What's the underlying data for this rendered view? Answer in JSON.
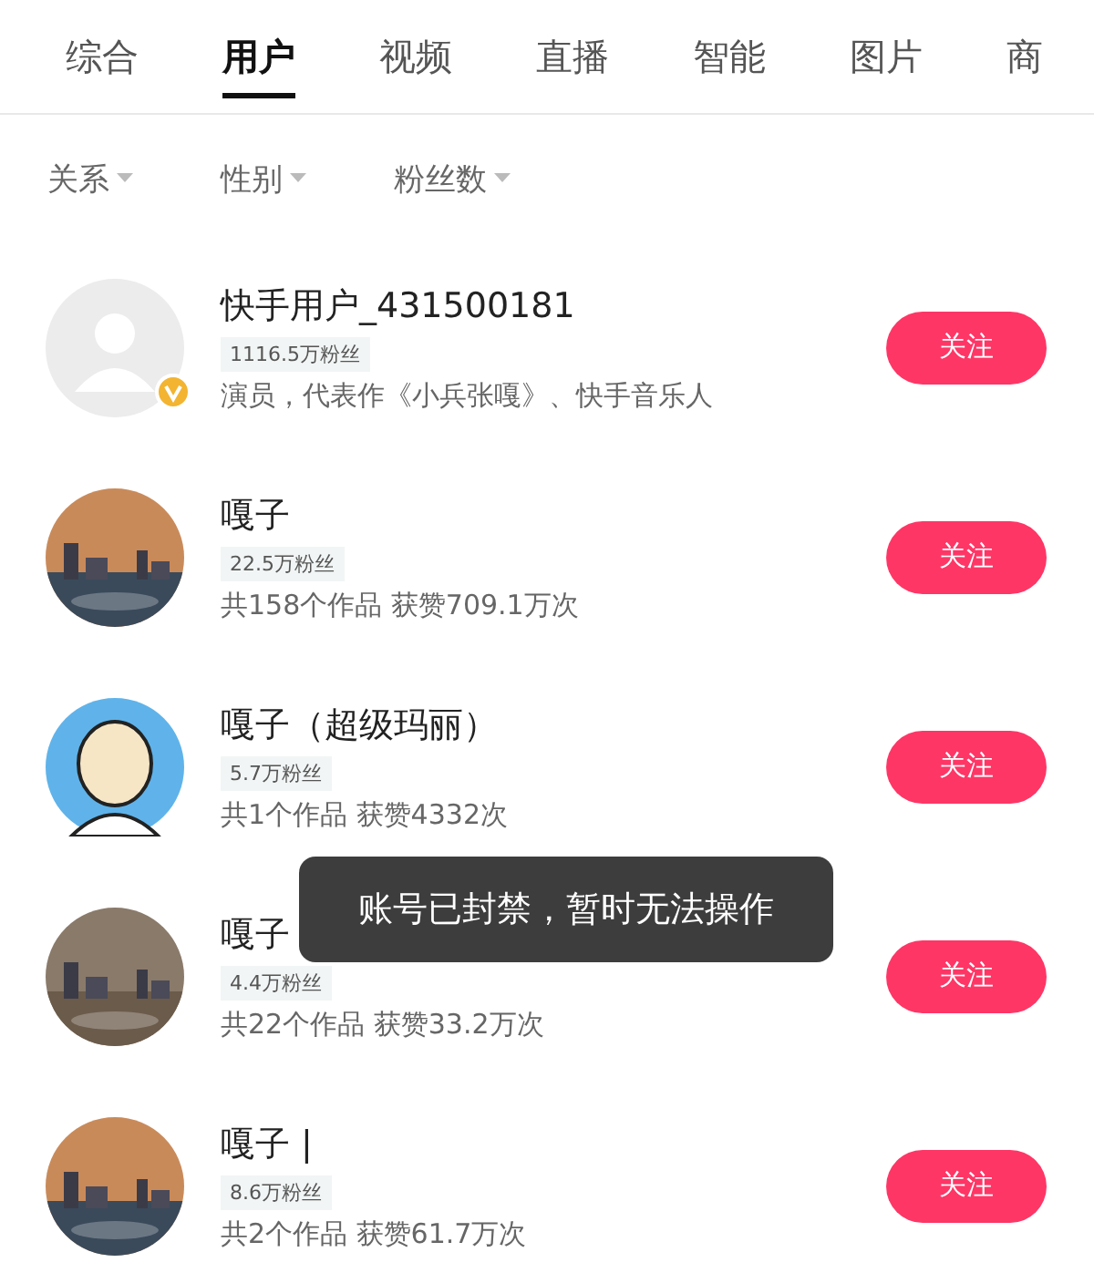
{
  "tabs": [
    {
      "label": "综合",
      "selected": false
    },
    {
      "label": "用户",
      "selected": true
    },
    {
      "label": "视频",
      "selected": false
    },
    {
      "label": "直播",
      "selected": false
    },
    {
      "label": "智能",
      "selected": false
    },
    {
      "label": "图片",
      "selected": false
    },
    {
      "label": "商",
      "selected": false
    }
  ],
  "filters": [
    {
      "label": "关系"
    },
    {
      "label": "性别"
    },
    {
      "label": "粉丝数"
    }
  ],
  "users": [
    {
      "name": "快手用户_431500181",
      "fans": "1116.5万粉丝",
      "info": "演员，代表作《小兵张嘎》、快手音乐人",
      "avatar": {
        "kind": "default"
      },
      "verified": true,
      "button": "关注"
    },
    {
      "name": "嘎子",
      "fans": "22.5万粉丝",
      "info": "共158个作品 获赞709.1万次",
      "verified": false,
      "button": "关注"
    },
    {
      "name": "嘎子（超级玛丽）",
      "fans": "5.7万粉丝",
      "info": "共1个作品 获赞4332次",
      "avatar": {
        "kind": "figure"
      },
      "verified": false,
      "button": "关注"
    },
    {
      "name": "嘎子",
      "fans": "4.4万粉丝",
      "info": "共22个作品 获赞33.2万次",
      "verified": false,
      "button": "关注"
    },
    {
      "name": "嘎子 |",
      "fans": "8.6万粉丝",
      "info": "共2个作品 获赞61.7万次",
      "verified": false,
      "button": "关注"
    }
  ],
  "toast": {
    "text": "账号已封禁，暂时无法操作"
  }
}
